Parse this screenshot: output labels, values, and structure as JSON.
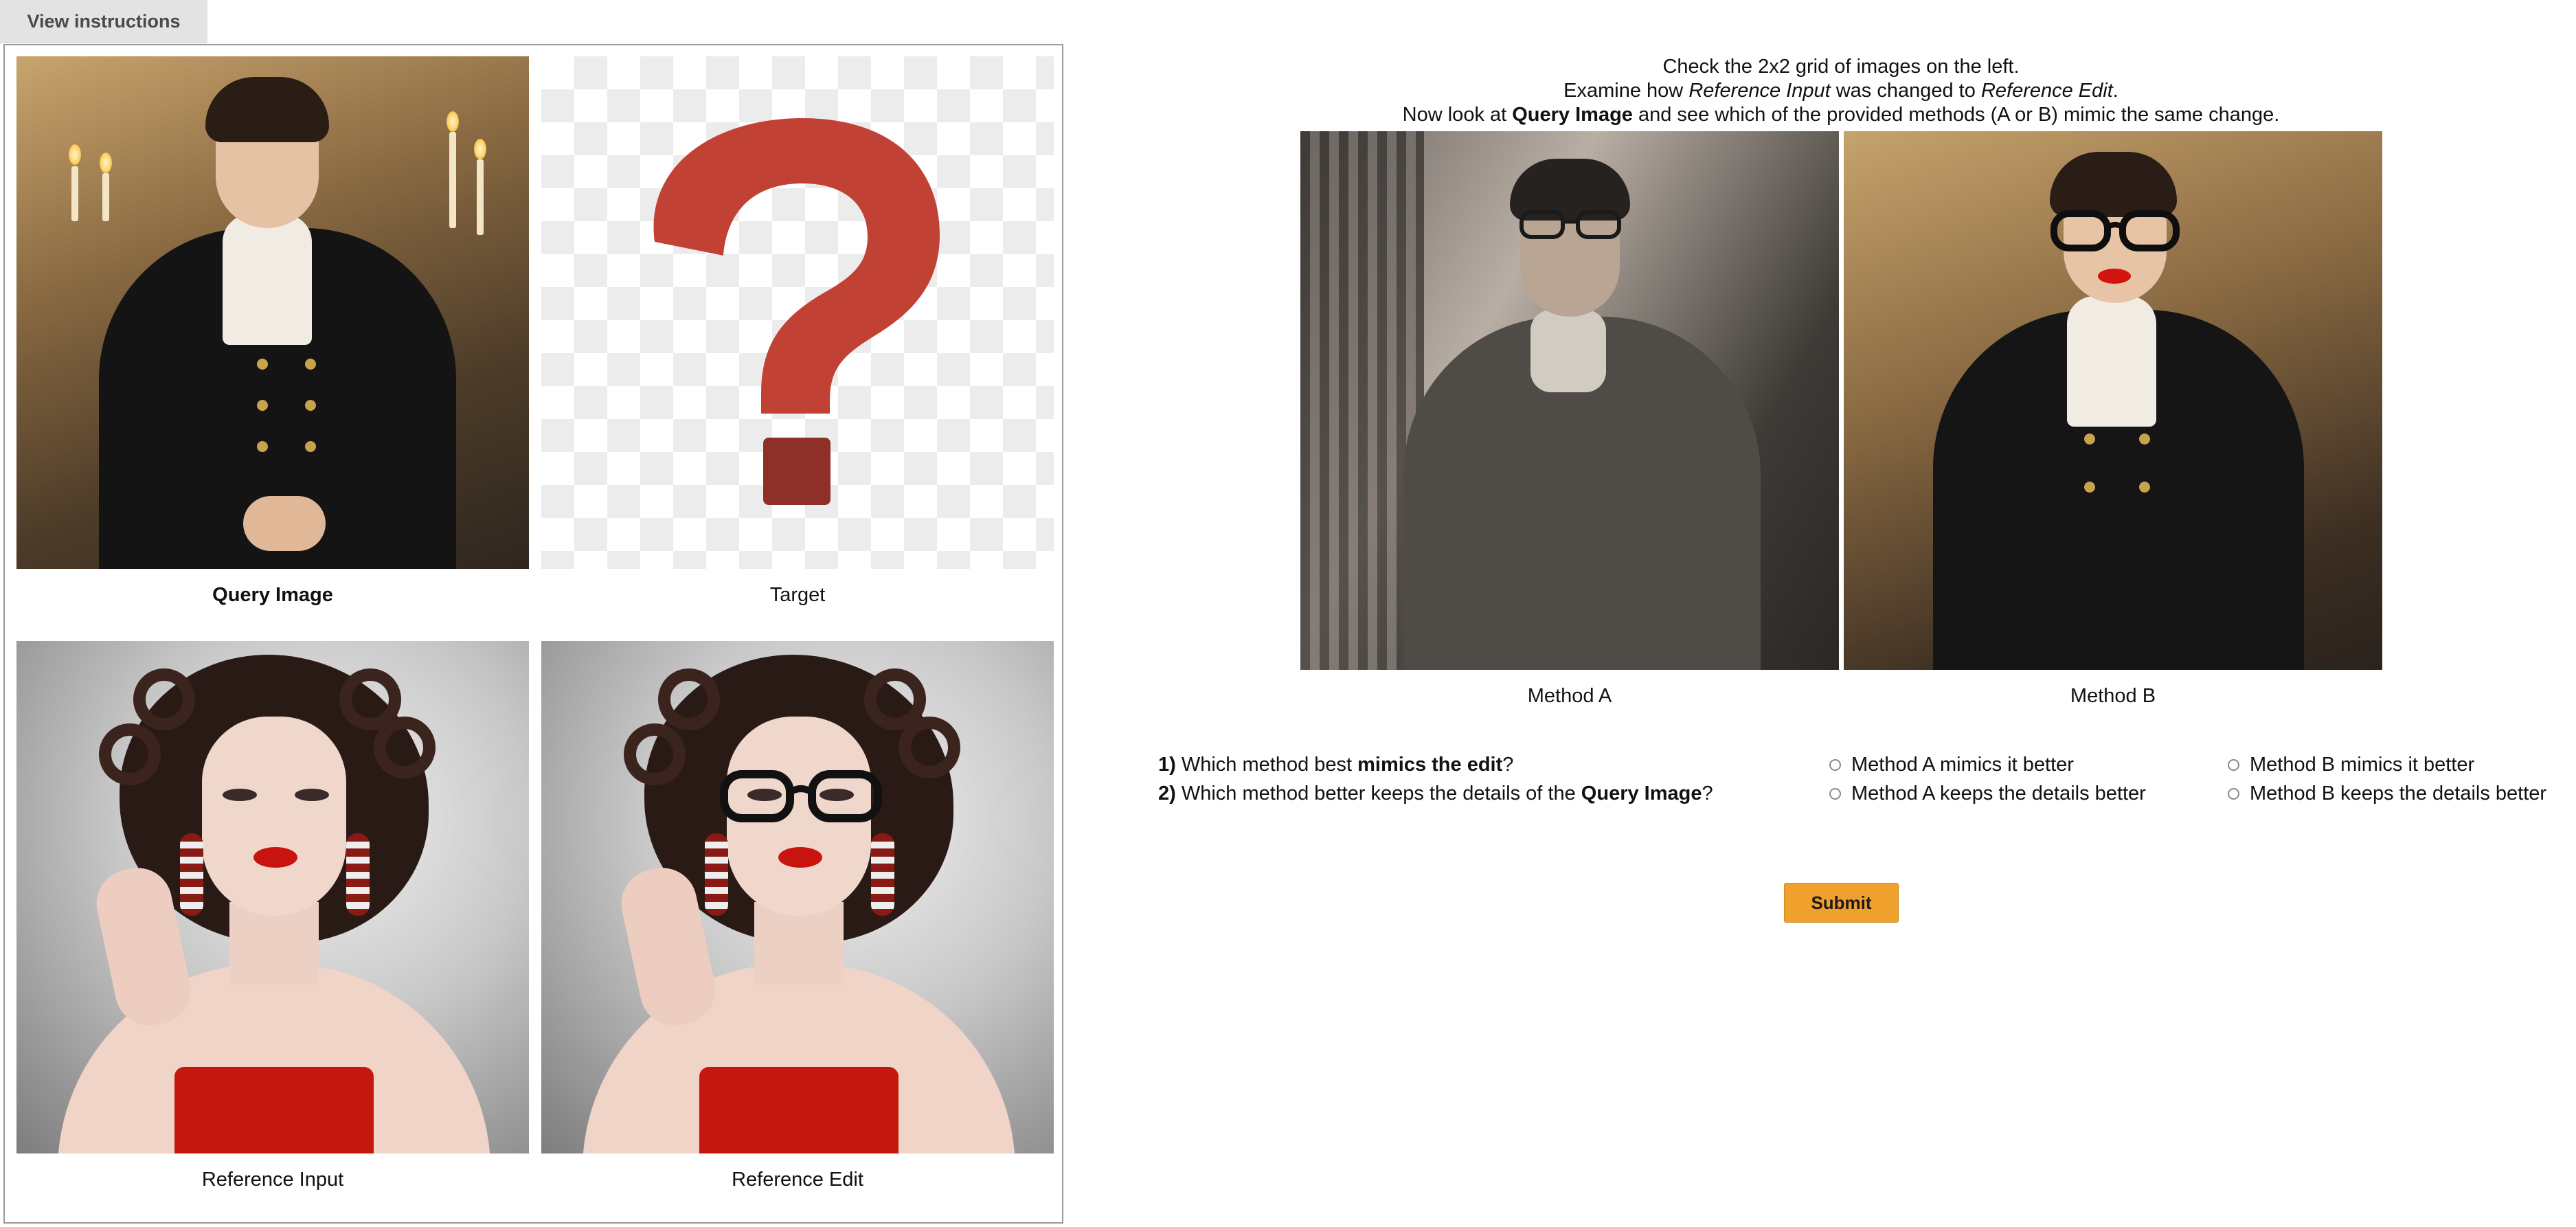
{
  "header": {
    "view_instructions_label": "View instructions"
  },
  "grid": {
    "query_caption": "Query Image",
    "target_caption": "Target",
    "ref_input_caption": "Reference Input",
    "ref_edit_caption": "Reference Edit"
  },
  "instructions": {
    "line1": "Check the 2x2 grid of images on the left.",
    "line2_a": "Examine how ",
    "line2_b": "Reference Input",
    "line2_c": " was changed to ",
    "line2_d": "Reference Edit",
    "line2_e": ".",
    "line3_a": "Now look at ",
    "line3_b": "Query Image",
    "line3_c": " and see which of the provided methods (A or B) mimic the same change."
  },
  "methods": {
    "a_caption": "Method A",
    "b_caption": "Method B"
  },
  "questions": {
    "q1_num": "1)",
    "q1_a": " Which method best ",
    "q1_b": "mimics the edit",
    "q1_c": "?",
    "q1_opt_a": "Method A mimics it better",
    "q1_opt_b": "Method B mimics it better",
    "q2_num": "2)",
    "q2_a": " Which method better keeps the details of the ",
    "q2_b": "Query Image",
    "q2_c": "?",
    "q2_opt_a": "Method A keeps the details better",
    "q2_opt_b": "Method B keeps the details better"
  },
  "submit_label": "Submit",
  "colors": {
    "submit_bg": "#f0a02c",
    "question_mark": "#c24135",
    "question_dot": "#8e2f28"
  }
}
